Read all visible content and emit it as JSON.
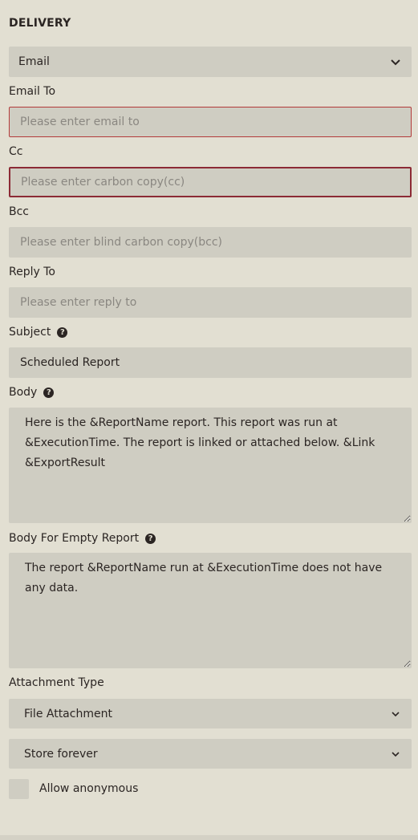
{
  "section": {
    "title": "DELIVERY"
  },
  "delivery_method": {
    "value": "Email"
  },
  "email_to": {
    "label": "Email To",
    "placeholder": "Please enter email to"
  },
  "cc": {
    "label": "Cc",
    "placeholder": "Please enter carbon copy(cc)"
  },
  "bcc": {
    "label": "Bcc",
    "placeholder": "Please enter blind carbon copy(bcc)"
  },
  "reply_to": {
    "label": "Reply To",
    "placeholder": "Please enter reply to"
  },
  "subject": {
    "label": "Subject",
    "value": "Scheduled Report"
  },
  "body": {
    "label": "Body",
    "value": "Here is the &ReportName report. This report was run at &ExecutionTime. The report is linked or attached below. &Link &ExportResult"
  },
  "body_empty": {
    "label": "Body For Empty Report",
    "value": "The report &ReportName run at &ExecutionTime does not have any data."
  },
  "attachment_type": {
    "label": "Attachment Type",
    "value": "File Attachment"
  },
  "storage": {
    "value": "Store forever"
  },
  "allow_anonymous": {
    "label": "Allow anonymous",
    "checked": false
  },
  "icons": {
    "help": "help-icon",
    "chevron": "chevron-down-icon"
  }
}
